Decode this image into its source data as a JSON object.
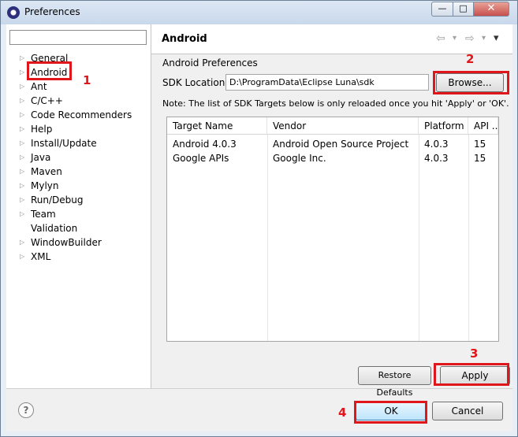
{
  "window": {
    "title": "Preferences",
    "minimize": "—",
    "maximize": "□",
    "close": "✕"
  },
  "filter": {
    "value": ""
  },
  "tree": {
    "items": [
      {
        "label": "General",
        "arrow": "▷"
      },
      {
        "label": "Android",
        "arrow": "▷"
      },
      {
        "label": "Ant",
        "arrow": "▷"
      },
      {
        "label": "C/C++",
        "arrow": "▷"
      },
      {
        "label": "Code Recommenders",
        "arrow": "▷"
      },
      {
        "label": "Help",
        "arrow": "▷"
      },
      {
        "label": "Install/Update",
        "arrow": "▷"
      },
      {
        "label": "Java",
        "arrow": "▷"
      },
      {
        "label": "Maven",
        "arrow": "▷"
      },
      {
        "label": "Mylyn",
        "arrow": "▷"
      },
      {
        "label": "Run/Debug",
        "arrow": "▷"
      },
      {
        "label": "Team",
        "arrow": "▷"
      },
      {
        "label": "Validation",
        "arrow": ""
      },
      {
        "label": "WindowBuilder",
        "arrow": "▷"
      },
      {
        "label": "XML",
        "arrow": "▷"
      }
    ]
  },
  "page": {
    "title": "Android",
    "nav": {
      "back": "⇦",
      "back_menu": "▾",
      "forward": "⇨",
      "forward_menu": "▾",
      "view_menu": "▾"
    },
    "section_label": "Android Preferences",
    "sdk_label": "SDK Location:",
    "sdk_value": "D:\\ProgramData\\Eclipse Luna\\sdk",
    "browse_label": "Browse...",
    "note": "Note: The list of SDK Targets below is only reloaded once you hit 'Apply' or 'OK'.",
    "table": {
      "headers": [
        "Target Name",
        "Vendor",
        "Platform",
        "API ..."
      ],
      "rows": [
        [
          "Android 4.0.3",
          "Android Open Source Project",
          "4.0.3",
          "15"
        ],
        [
          "Google APIs",
          "Google Inc.",
          "4.0.3",
          "15"
        ]
      ]
    },
    "restore_label": "Restore Defaults",
    "apply_label": "Apply"
  },
  "footer": {
    "help": "?",
    "ok_label": "OK",
    "cancel_label": "Cancel"
  },
  "annotations": {
    "m1": "1",
    "m2": "2",
    "m3": "3",
    "m4": "4",
    "color": "#e0161b"
  }
}
